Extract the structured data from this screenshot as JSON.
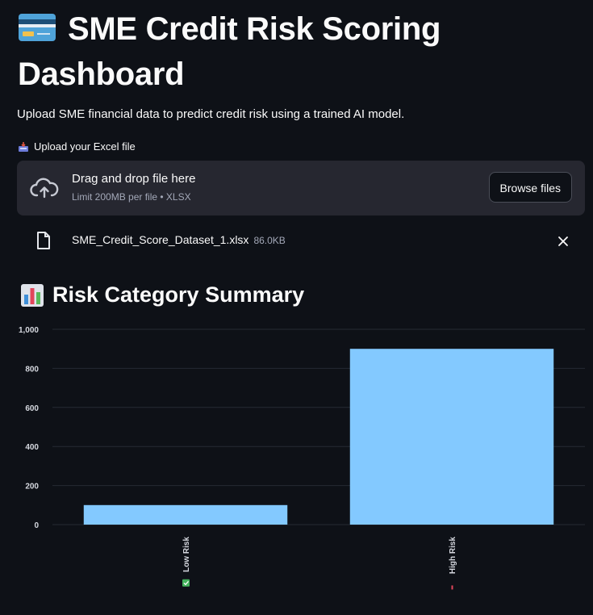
{
  "header": {
    "title": "SME Credit Risk Scoring Dashboard",
    "title_icon": "credit-card-icon",
    "subtitle": "Upload SME financial data to predict credit risk using a trained AI model."
  },
  "uploader": {
    "label": "Upload your Excel file",
    "label_icon": "inbox-tray-icon",
    "drop_text": "Drag and drop file here",
    "limit_text": "Limit 200MB per file • XLSX",
    "browse_label": "Browse files",
    "file": {
      "name": "SME_Credit_Score_Dataset_1.xlsx",
      "size": "86.0KB"
    }
  },
  "summary": {
    "title": "Risk Category Summary",
    "title_icon": "bar-chart-icon"
  },
  "chart_data": {
    "type": "bar",
    "categories": [
      "Low Risk",
      "High Risk"
    ],
    "category_icons": [
      "green-check-icon",
      "red-cross-icon"
    ],
    "values": [
      100,
      900
    ],
    "ylim": [
      0,
      1000
    ],
    "yticks": [
      0,
      200,
      400,
      600,
      800,
      1000
    ],
    "ytick_labels": [
      "0",
      "200",
      "400",
      "600",
      "800",
      "1,000"
    ],
    "xlabel": "",
    "ylabel": "",
    "grid": true,
    "bar_color": "#83c9ff"
  },
  "colors": {
    "background": "#0e1117",
    "panel": "#262730",
    "text": "#fafafa",
    "muted": "#a3a8b8",
    "bar": "#83c9ff"
  }
}
